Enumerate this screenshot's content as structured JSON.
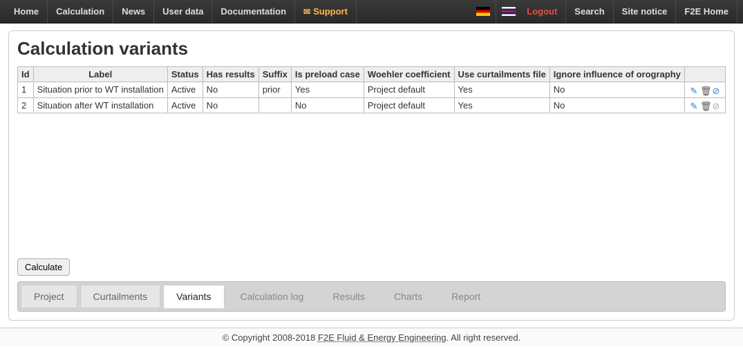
{
  "nav": {
    "left": [
      "Home",
      "Calculation",
      "News",
      "User data",
      "Documentation"
    ],
    "support": "Support",
    "right_logout": "Logout",
    "right": [
      "Search",
      "Site notice",
      "F2E Home"
    ]
  },
  "title": "Calculation variants",
  "columns": [
    "Id",
    "Label",
    "Status",
    "Has results",
    "Suffix",
    "Is preload case",
    "Woehler coefficient",
    "Use curtailments file",
    "Ignore influence of orography",
    ""
  ],
  "rows": [
    {
      "id": "1",
      "label": "Situation prior to WT installation",
      "status": "Active",
      "has_results": "No",
      "suffix": "prior",
      "is_preload": "Yes",
      "woehler": "Project default",
      "curt": "Yes",
      "orography": "No",
      "block_active": true
    },
    {
      "id": "2",
      "label": "Situation after WT installation",
      "status": "Active",
      "has_results": "No",
      "suffix": "",
      "is_preload": "No",
      "woehler": "Project default",
      "curt": "Yes",
      "orography": "No",
      "block_active": false
    }
  ],
  "calc_btn": "Calculate",
  "tabs": [
    {
      "label": "Project",
      "state": "dim"
    },
    {
      "label": "Curtailments",
      "state": "dim"
    },
    {
      "label": "Variants",
      "state": "active"
    },
    {
      "label": "Calculation log",
      "state": "inactive"
    },
    {
      "label": "Results",
      "state": "inactive"
    },
    {
      "label": "Charts",
      "state": "inactive"
    },
    {
      "label": "Report",
      "state": "inactive"
    }
  ],
  "footer": {
    "prefix": "© Copyright 2008-2018 ",
    "company": "F2E Fluid & Energy Engineering",
    "suffix": ". All right reserved."
  }
}
